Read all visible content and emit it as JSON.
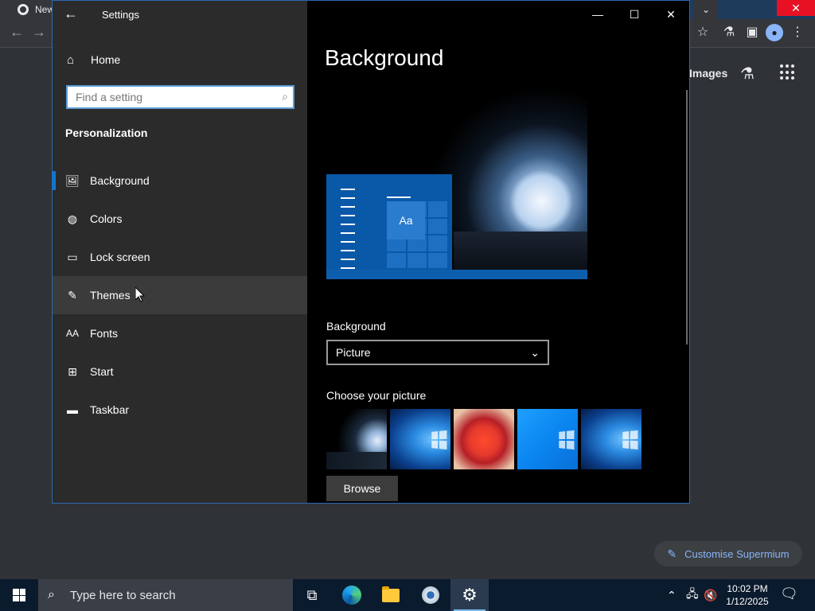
{
  "browser": {
    "tab_title": "New",
    "images_label": "Images",
    "customise_label": "Customise Supermium"
  },
  "settings": {
    "window_title": "Settings",
    "home_label": "Home",
    "search_placeholder": "Find a setting",
    "section_title": "Personalization",
    "nav_items": [
      {
        "label": "Background",
        "icon": "picture-icon"
      },
      {
        "label": "Colors",
        "icon": "palette-icon"
      },
      {
        "label": "Lock screen",
        "icon": "lock-screen-icon"
      },
      {
        "label": "Themes",
        "icon": "themes-icon"
      },
      {
        "label": "Fonts",
        "icon": "fonts-icon"
      },
      {
        "label": "Start",
        "icon": "start-icon"
      },
      {
        "label": "Taskbar",
        "icon": "taskbar-icon"
      }
    ],
    "selected_item": "Background",
    "hovered_item": "Themes",
    "page_title": "Background",
    "preview_tile_text": "Aa",
    "background_label": "Background",
    "background_value": "Picture",
    "choose_picture_label": "Choose your picture",
    "browse_label": "Browse"
  },
  "taskbar": {
    "search_placeholder": "Type here to search",
    "time": "10:02 PM",
    "date": "1/12/2025"
  },
  "colors": {
    "accent": "#0a78d4",
    "close_red": "#e81123",
    "sidebar_bg": "#2b2b2b"
  }
}
